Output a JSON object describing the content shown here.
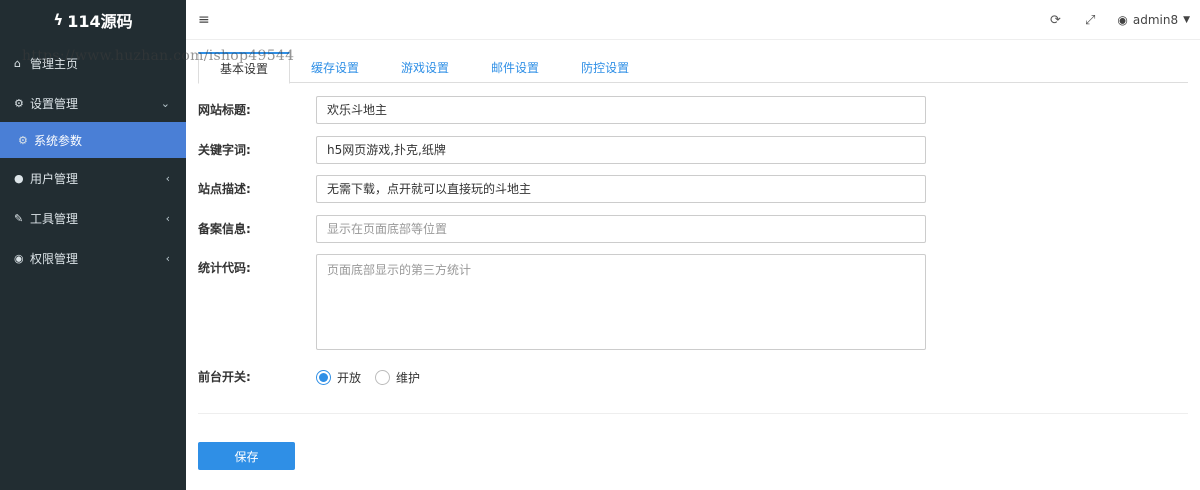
{
  "app": {
    "logo_text": "114源码",
    "watermark": "https://www.huzhan.com/ishop49544"
  },
  "sidebar": {
    "items": [
      {
        "label": "管理主页",
        "icon": "home-icon"
      },
      {
        "label": "设置管理",
        "icon": "cogs-icon"
      },
      {
        "label": "系统参数",
        "icon": "gear-icon"
      },
      {
        "label": "用户管理",
        "icon": "users-icon"
      },
      {
        "label": "工具管理",
        "icon": "wrench-icon"
      },
      {
        "label": "权限管理",
        "icon": "user-circle-icon"
      }
    ]
  },
  "header": {
    "username": "admin8"
  },
  "tabs": [
    {
      "label": "基本设置"
    },
    {
      "label": "缓存设置"
    },
    {
      "label": "游戏设置"
    },
    {
      "label": "邮件设置"
    },
    {
      "label": "防控设置"
    }
  ],
  "form": {
    "site_title": {
      "label": "网站标题:",
      "value": "欢乐斗地主"
    },
    "keywords": {
      "label": "关键字词:",
      "value": "h5网页游戏,扑克,纸牌"
    },
    "description": {
      "label": "站点描述:",
      "value": "无需下载，点开就可以直接玩的斗地主"
    },
    "icp": {
      "label": "备案信息:",
      "placeholder": "显示在页面底部等位置"
    },
    "stats_code": {
      "label": "统计代码:",
      "placeholder": "页面底部显示的第三方统计"
    },
    "frontend_switch": {
      "label": "前台开关:",
      "options": [
        "开放",
        "维护"
      ],
      "selected": "开放"
    }
  },
  "actions": {
    "save_label": "保存"
  },
  "colors": {
    "sidebar_bg": "#222d32",
    "active_menu": "#4a7fd6",
    "accent": "#2f8fe6"
  }
}
